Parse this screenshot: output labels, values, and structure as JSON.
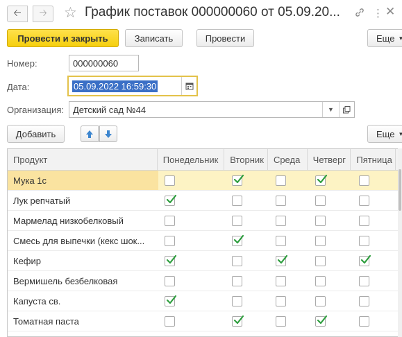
{
  "window": {
    "title": "График поставок 000000060 от 05.09.2022 16:59:30",
    "title_shown": "График поставок 000000060 от 05.09.20..."
  },
  "toolbar": {
    "post_close_label": "Провести и закрыть",
    "save_label": "Записать",
    "post_label": "Провести",
    "more_label": "Еще"
  },
  "form": {
    "number_label": "Номер:",
    "number_value": "000000060",
    "date_label": "Дата:",
    "date_value": "05.09.2022 16:59:30",
    "org_label": "Организация:",
    "org_value": "Детский сад №44"
  },
  "table_toolbar": {
    "add_label": "Добавить",
    "more_label": "Еще"
  },
  "table": {
    "columns": [
      "Продукт",
      "Понедельник",
      "Вторник",
      "Среда",
      "Четверг",
      "Пятница"
    ],
    "rows": [
      {
        "product": "Мука 1с",
        "checks": [
          false,
          true,
          false,
          true,
          false
        ]
      },
      {
        "product": "Лук репчатый",
        "checks": [
          true,
          false,
          false,
          false,
          false
        ]
      },
      {
        "product": "Мармелад низкобелковый",
        "checks": [
          false,
          false,
          false,
          false,
          false
        ]
      },
      {
        "product": "Смесь для выпечки (кекс шок...",
        "checks": [
          false,
          true,
          false,
          false,
          false
        ]
      },
      {
        "product": "Кефир",
        "checks": [
          true,
          false,
          true,
          false,
          true
        ]
      },
      {
        "product": "Вермишель безбелковая",
        "checks": [
          false,
          false,
          false,
          false,
          false
        ]
      },
      {
        "product": "Капуста св.",
        "checks": [
          true,
          false,
          false,
          false,
          false
        ]
      },
      {
        "product": "Томатная паста",
        "checks": [
          false,
          true,
          false,
          true,
          false
        ]
      }
    ]
  },
  "colors": {
    "accent_yellow": "#f5cf0d",
    "check_green": "#2e9e3e",
    "selection_blue": "#3a6fc6",
    "active_row": "#fdf3c4"
  }
}
